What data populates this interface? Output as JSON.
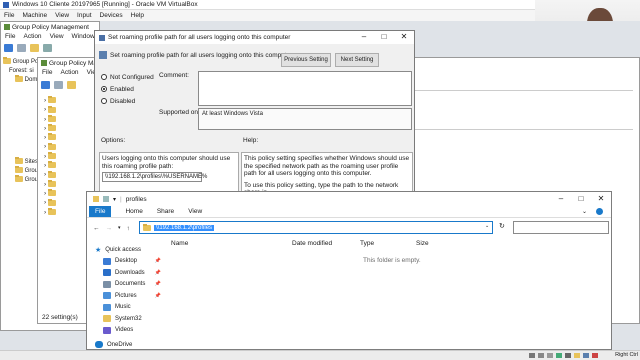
{
  "vbox": {
    "title": "Windows 10 Cliente 20197965 [Running] - Oracle VM VirtualBox",
    "menu": [
      "File",
      "Machine",
      "View",
      "Input",
      "Devices",
      "Help"
    ]
  },
  "gpm": {
    "title": "Group Policy Management",
    "menu": [
      "File",
      "Action",
      "View",
      "Window"
    ],
    "tree": [
      "Group Policy",
      "Forest: si",
      "Dom",
      "Sites",
      "Group",
      "Group"
    ]
  },
  "gpme": {
    "title_short": "Group Policy Ma",
    "menu": [
      "File",
      "Action",
      "View"
    ],
    "status": "22 setting(s)"
  },
  "dialog": {
    "title": "Set roaming profile path for all users logging onto this computer",
    "header": "Set roaming profile path for all users logging onto this computer",
    "prev_btn": "Previous Setting",
    "next_btn": "Next Setting",
    "options": [
      "Not Configured",
      "Enabled",
      "Disabled"
    ],
    "selected_option": "Enabled",
    "comment_label": "Comment:",
    "supported_label": "Supported on:",
    "supported_value": "At least Windows Vista",
    "options_label": "Options:",
    "help_label": "Help:",
    "option_text": "Users logging onto this computer should use this roaming profile path:",
    "option_value": "\\\\192.168.1.2\\profiles\\%USERNAME%",
    "help_p1": "This policy setting specifies whether Windows should use the specified network path as the roaming user profile path for all users logging onto this computer.",
    "help_p2": "To use this policy setting, type the path to the network share in"
  },
  "explorer": {
    "title": "profiles",
    "ribbon_tabs": [
      "File",
      "Home",
      "Share",
      "View"
    ],
    "address": "\\\\192.168.1.2\\profiles",
    "columns": [
      "Name",
      "Date modified",
      "Type",
      "Size"
    ],
    "empty_message": "This folder is empty.",
    "quick_access": "Quick access",
    "nav": [
      {
        "label": "Desktop",
        "icon": "desktop-icon",
        "color": "#3a7bd5",
        "pinned": true
      },
      {
        "label": "Downloads",
        "icon": "downloads-icon",
        "color": "#2a6fc9",
        "pinned": true
      },
      {
        "label": "Documents",
        "icon": "documents-icon",
        "color": "#7a8fa6",
        "pinned": true
      },
      {
        "label": "Pictures",
        "icon": "pictures-icon",
        "color": "#4a90d9",
        "pinned": true
      },
      {
        "label": "Music",
        "icon": "music-icon",
        "color": "#4a90d9",
        "pinned": false
      },
      {
        "label": "System32",
        "icon": "folder-icon",
        "color": "#e8c35a",
        "pinned": false
      },
      {
        "label": "Videos",
        "icon": "videos-icon",
        "color": "#6a5acd",
        "pinned": false
      }
    ],
    "onedrive": "OneDrive"
  },
  "taskbar": {
    "right_ctrl": "Right Ctrl"
  }
}
